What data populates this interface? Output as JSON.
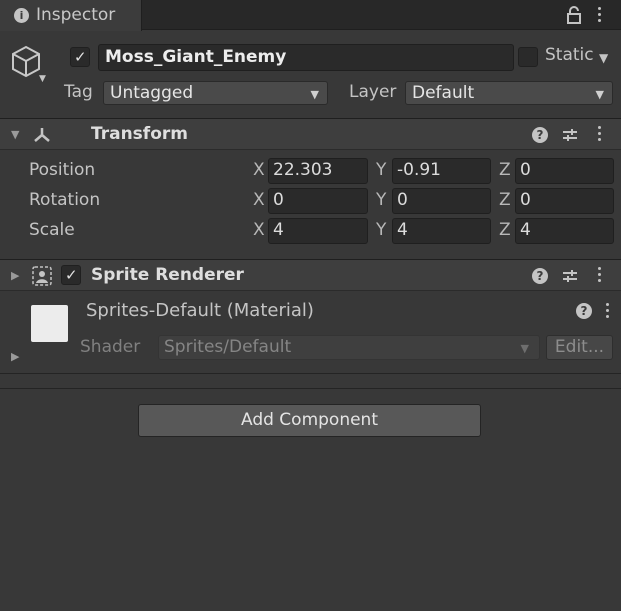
{
  "tab": {
    "title": "Inspector"
  },
  "header": {
    "object_name": "Moss_Giant_Enemy",
    "static_label": "Static",
    "tag_label": "Tag",
    "tag_value": "Untagged",
    "layer_label": "Layer",
    "layer_value": "Default"
  },
  "transform": {
    "title": "Transform",
    "rows": [
      {
        "label": "Position",
        "x": "22.303",
        "y": "-0.91",
        "z": "0"
      },
      {
        "label": "Rotation",
        "x": "0",
        "y": "0",
        "z": "0"
      },
      {
        "label": "Scale",
        "x": "4",
        "y": "4",
        "z": "4"
      }
    ],
    "axis_x": "X",
    "axis_y": "Y",
    "axis_z": "Z"
  },
  "sprite_renderer": {
    "title": "Sprite Renderer",
    "enabled": true
  },
  "material": {
    "name": "Sprites-Default (Material)",
    "shader_label": "Shader",
    "shader_value": "Sprites/Default",
    "edit_label": "Edit..."
  },
  "add_component_label": "Add Component",
  "colors": {
    "background": "#383838",
    "tabbar": "#282828",
    "field": "#2a2a2a",
    "button": "#585858"
  },
  "icons": [
    "info-icon",
    "lock-icon",
    "menu-icon",
    "gameobject-cube-icon",
    "transform-icon",
    "sprite-renderer-icon",
    "help-icon",
    "presets-icon"
  ]
}
